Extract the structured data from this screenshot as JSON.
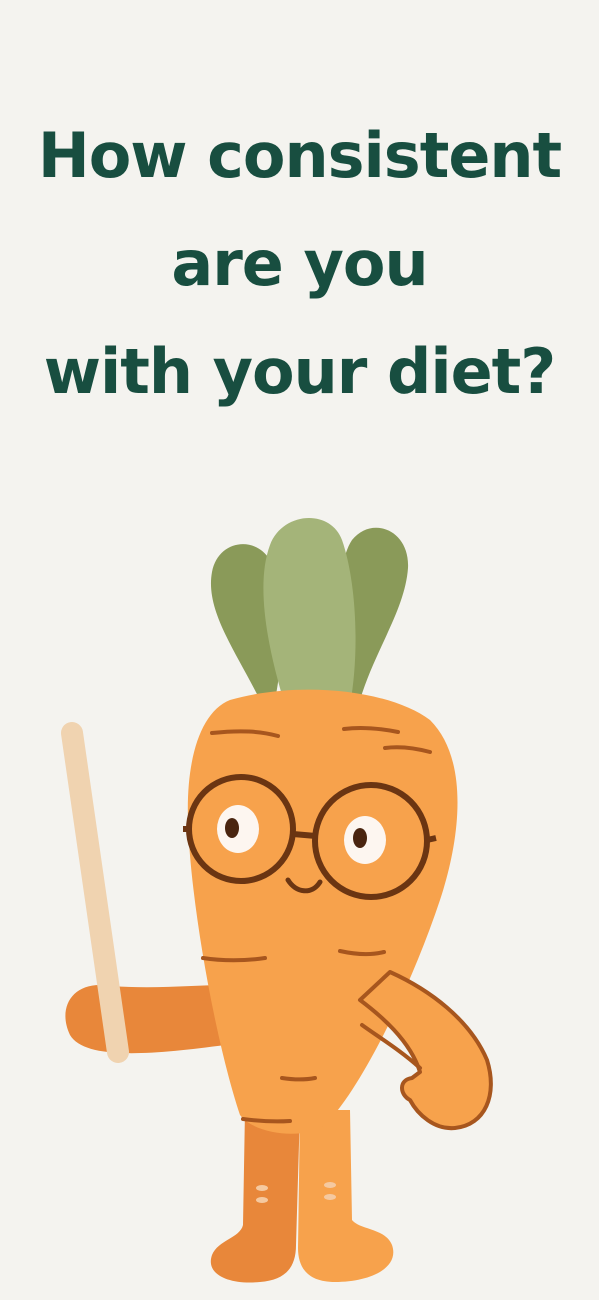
{
  "question": {
    "line1": "How consistent",
    "line2": "are you",
    "line3": "with your diet?"
  },
  "illustration": {
    "subject": "carrot-mascot",
    "props": [
      "glasses",
      "pointer-stick"
    ],
    "colors": {
      "carrot": "#f7a24c",
      "carrot_shadow": "#e8873a",
      "outline": "#a7561e",
      "leaf_dark": "#8a9a59",
      "leaf_light": "#a4b479",
      "stick": "#f0d3b0",
      "glasses": "#6b3512",
      "heading": "#184e40",
      "background": "#f4f3ef"
    }
  }
}
